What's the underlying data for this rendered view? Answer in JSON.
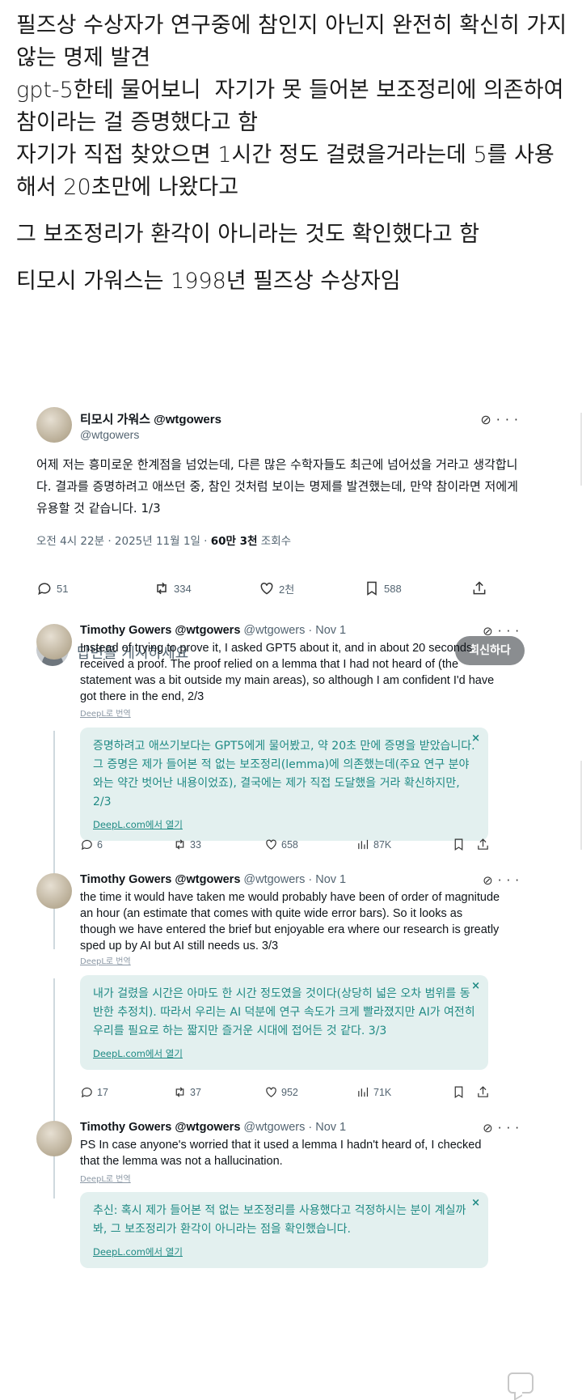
{
  "post": {
    "lines": [
      "필즈상 수상자가 연구중에 참인지 아닌지 완전히 확신히 가지 않는 명제 발견",
      "gpt-5한테 물어보니  자기가 못 들어본 보조정리에 의존하여 참이라는 걸 증명했다고 함",
      "자기가 직접 찾았으면 1시간 정도 걸렸을거라는데 5를 사용해서 20초만에 나왔다고",
      "그 보조정리가 환각이 아니라는 것도 확인했다고 함",
      "티모시 가워스는 1998년 필즈상 수상자임"
    ]
  },
  "main_tweet": {
    "name": "티모시 가워스 @wtgowers",
    "handle": "@wtgowers",
    "text": "어제 저는 흥미로운 한계점을 넘었는데, 다른 많은 수학자들도 최근에 넘어섰을 거라고 생각합니다. 결과를 증명하려고 애쓰던 중, 참인 것처럼 보이는 명제를 발견했는데, 만약 참이라면 저에게 유용할 것 같습니다. 1/3",
    "time": "오전 4시 22분 · 2025년 11월 1일 · ",
    "views": "60만 3천",
    "views_label": " 조회수",
    "replies": "51",
    "retweets": "334",
    "likes": "2천",
    "bookmarks": "588"
  },
  "reply": {
    "placeholder": "답변을 게시하세요",
    "button": "회신하다"
  },
  "thread": [
    {
      "name": "Timothy Gowers @wtgowers",
      "handle": "@wtgowers · Nov 1",
      "text": "Instead of trying to prove it, I asked GPT5 about it, and in about 20 seconds received a proof. The proof relied on a lemma that I had not heard of (the statement was a bit outside my main areas), so although I am confident I'd have got there in the end, 2/3",
      "deepl": "DeepL로 번역",
      "translation": "증명하려고 애쓰기보다는 GPT5에게 물어봤고, 약 20초 만에 증명을 받았습니다. 그 증명은 제가 들어본 적 없는 보조정리(lemma)에 의존했는데(주요 연구 분야와는 약간 벗어난 내용이었죠), 결국에는 제가 직접 도달했을 거라 확신하지만, 2/3",
      "open_link": "DeepL.com에서 열기",
      "replies": "6",
      "retweets": "33",
      "likes": "658",
      "views": "87K"
    },
    {
      "name": "Timothy Gowers @wtgowers",
      "handle": "@wtgowers · Nov 1",
      "text": "the time it would have taken me would probably have been of order of magnitude an hour (an estimate that comes with quite wide error bars). So it looks as though we have entered the brief but enjoyable era where our research is greatly sped up by AI but AI still needs us. 3/3",
      "deepl": "DeepL로 번역",
      "translation": "내가 걸렸을 시간은 아마도 한 시간 정도였을 것이다(상당히 넓은 오차 범위를 동반한 추정치). 따라서 우리는 AI 덕분에 연구 속도가 크게 빨라졌지만 AI가 여전히 우리를 필요로 하는 짧지만 즐거운 시대에 접어든 것 같다. 3/3",
      "open_link": "DeepL.com에서 열기",
      "replies": "17",
      "retweets": "37",
      "likes": "952",
      "views": "71K"
    },
    {
      "name": "Timothy Gowers @wtgowers",
      "handle": "@wtgowers · Nov 1",
      "text": "PS In case anyone's worried that it used a lemma I hadn't heard of, I checked that the lemma was not a hallucination.",
      "deepl": "DeepL로 번역",
      "translation": "추신: 혹시 제가 들어본 적 없는 보조정리를 사용했다고 걱정하시는 분이 계실까 봐, 그 보조정리가 환각이 아니라는 점을 확인했습니다.",
      "open_link": "DeepL.com에서 열기"
    }
  ],
  "icons": {
    "grok": "grok-icon",
    "more": "more-icon",
    "reply": "reply-icon",
    "retweet": "retweet-icon",
    "like": "heart-icon",
    "bookmark": "bookmark-icon",
    "share": "share-icon",
    "views": "views-icon",
    "close": "close-icon"
  },
  "colors": {
    "translation_bg": "#e3f0ef",
    "translation_text": "#1f8a84",
    "reply_button": "#8a8d90"
  }
}
